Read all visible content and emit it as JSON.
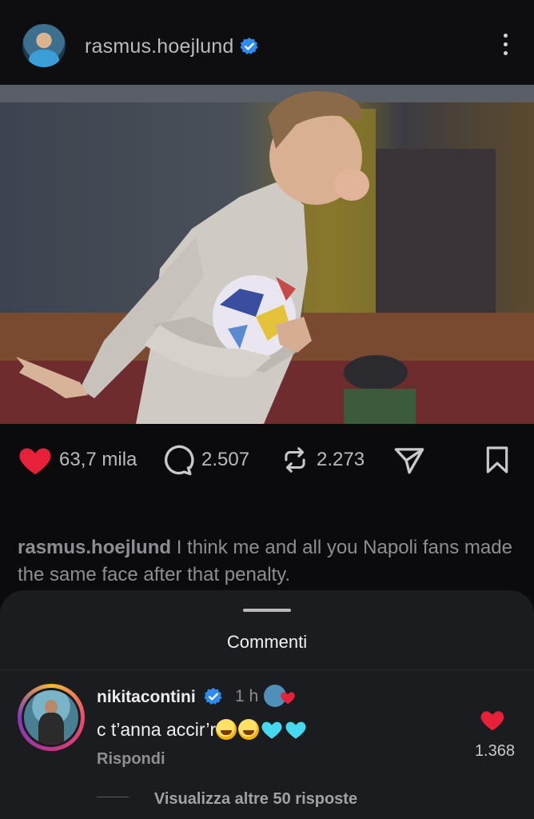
{
  "post": {
    "username": "rasmus.hoejlund",
    "likes": "63,7 mila",
    "comments": "2.507",
    "reposts": "2.273",
    "caption_user": "rasmus.hoejlund",
    "caption_text": " I think me and all you Napoli fans made the same face after that penalty."
  },
  "sheet": {
    "title": "Commenti",
    "comment": {
      "username": "nikitacontini",
      "time": "1 h",
      "text": "c t’anna accir’r",
      "reply_label": "Rispondi",
      "like_count": "1.368",
      "more_replies": "Visualizza altre 50 risposte"
    }
  },
  "colors": {
    "like_red": "#e8213a",
    "verified_blue": "#2f8bf0",
    "emoji_cyan": "#45d8ee"
  }
}
